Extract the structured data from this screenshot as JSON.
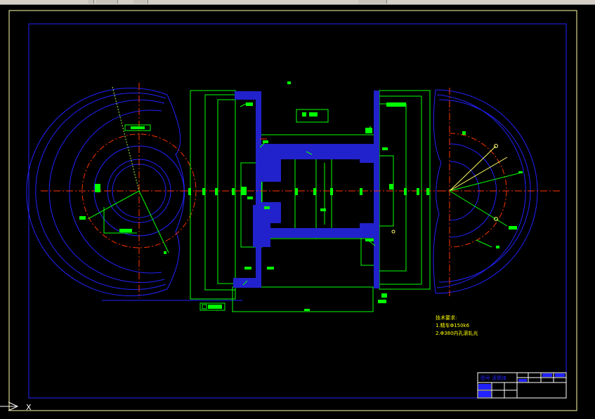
{
  "toolbar": {
    "items": [
      "",
      "",
      "",
      ""
    ]
  },
  "notes": {
    "heading": "技术要求:",
    "line1": "1.精车Φ150k6",
    "line2": "2.Φ380内孔滚轧光"
  },
  "title_block": {
    "name_cell": "图号  滚筒体"
  },
  "ucs": {
    "x_label": "X"
  },
  "colors": {
    "background": "#000000",
    "frame": "#0000ff",
    "outer_frame": "#ffffaa",
    "geometry": "#0000ff",
    "hatch": "#2222dd",
    "centerline": "#ff2200",
    "dimension": "#00ff00",
    "dim_text": "#00ff00",
    "notes": "#ffff00",
    "white": "#ffffff"
  }
}
